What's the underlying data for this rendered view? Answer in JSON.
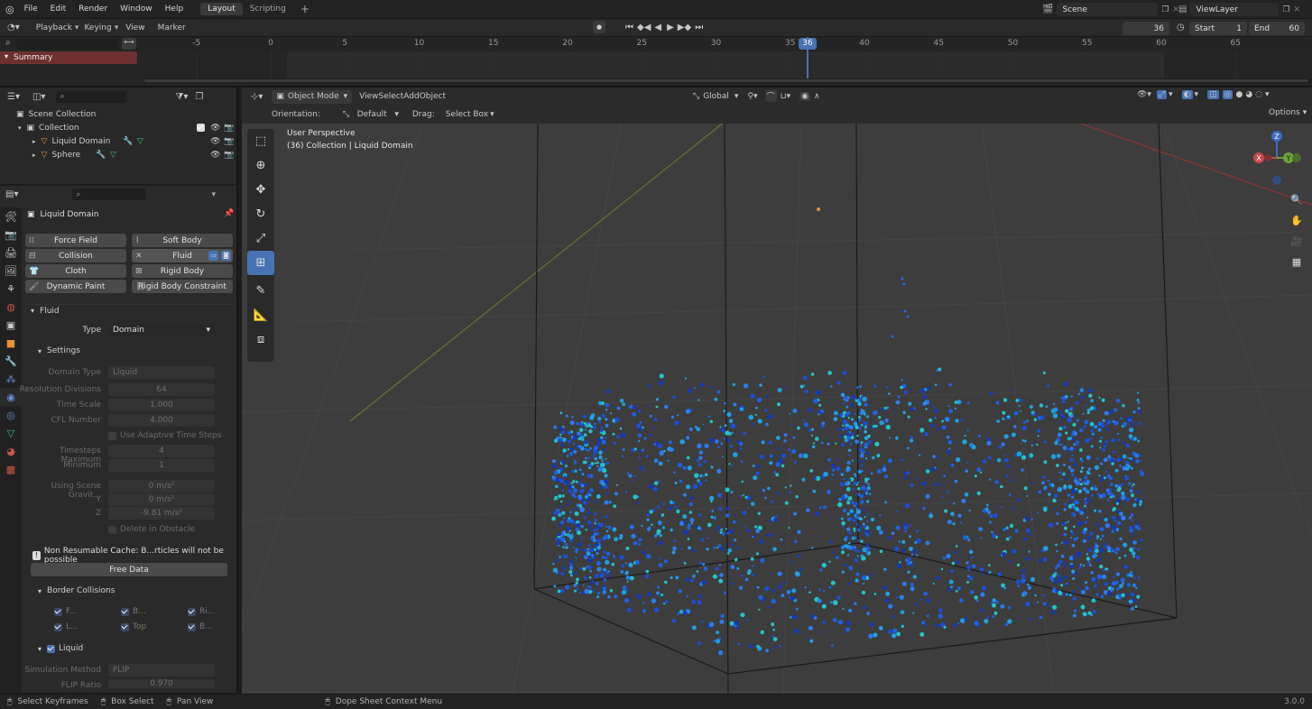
{
  "topbar": {
    "menus": [
      "File",
      "Edit",
      "Render",
      "Window",
      "Help"
    ],
    "workspaces": [
      {
        "label": "Layout",
        "active": true
      },
      {
        "label": "Scripting",
        "active": false
      }
    ],
    "add_tab": "+",
    "scene": "Scene",
    "view_layer": "ViewLayer"
  },
  "timeline": {
    "menus": [
      "Playback",
      "Keying",
      "View",
      "Marker"
    ],
    "current_frame": "36",
    "start_label": "Start",
    "start": "1",
    "end_label": "End",
    "end": "60",
    "summary": "Summary",
    "ticks": [
      "-5",
      "0",
      "5",
      "10",
      "15",
      "20",
      "25",
      "30",
      "35",
      "36",
      "40",
      "45",
      "50",
      "55",
      "60",
      "65"
    ]
  },
  "outliner": {
    "scene_collection": "Scene Collection",
    "collection": "Collection",
    "items": [
      "Liquid Domain",
      "Sphere"
    ]
  },
  "properties": {
    "object_name": "Liquid Domain",
    "physics_buttons": [
      {
        "label": "Force Field",
        "icon": "field-icon"
      },
      {
        "label": "Soft Body",
        "icon": "softbody-icon"
      },
      {
        "label": "Collision",
        "icon": "collision-icon"
      },
      {
        "label": "Fluid",
        "icon": "close-icon"
      },
      {
        "label": "Cloth",
        "icon": "cloth-icon"
      },
      {
        "label": "Rigid Body",
        "icon": "rigidbody-icon"
      },
      {
        "label": "Dynamic Paint",
        "icon": "brush-icon"
      },
      {
        "label": "Rigid Body Constraint",
        "icon": "constraint-icon"
      }
    ],
    "fluid_panel": "Fluid",
    "type_label": "Type",
    "type_value": "Domain",
    "settings_panel": "Settings",
    "settings": [
      {
        "label": "Domain Type",
        "value": "Liquid"
      },
      {
        "label": "Resolution Divisions",
        "value": "64"
      },
      {
        "label": "Time Scale",
        "value": "1.000"
      },
      {
        "label": "CFL Number",
        "value": "4.000"
      },
      {
        "label": "Use Adaptive Time Steps",
        "value": ""
      },
      {
        "label": "Timesteps Maximum",
        "value": "4"
      },
      {
        "label": "Minimum",
        "value": "1"
      },
      {
        "label": "Using Scene Gravit...",
        "value": "0 m/s²"
      },
      {
        "label": "Y",
        "value": "0 m/s²"
      },
      {
        "label": "Z",
        "value": "-9.81 m/s²"
      },
      {
        "label": "Delete in Obstacle",
        "value": ""
      }
    ],
    "warning": "Non Resumable Cache: B...rticles will not be possible",
    "free_data": "Free Data",
    "border_panel": "Border Collisions",
    "border_items": [
      "F...",
      "B...",
      "Ri...",
      "L...",
      "Top",
      "B..."
    ],
    "liquid_panel": "Liquid",
    "liquid_settings": [
      {
        "label": "Simulation Method",
        "value": "FLIP"
      },
      {
        "label": "FLIP Ratio",
        "value": "0.970"
      }
    ]
  },
  "viewport": {
    "mode": "Object Mode",
    "menus": [
      "View",
      "Select",
      "Add",
      "Object"
    ],
    "transform": "Global",
    "orientation_label": "Orientation:",
    "orientation": "Default",
    "drag_label": "Drag:",
    "drag": "Select Box",
    "options": "Options",
    "perspective": "User Perspective",
    "collection_info": "(36) Collection | Liquid Domain",
    "gizmo_axes": [
      "Z",
      "X",
      "Y"
    ]
  },
  "statusbar": {
    "items": [
      "Select Keyframes",
      "Box Select",
      "Pan View",
      "Dope Sheet Context Menu"
    ],
    "version": "3.0.0"
  }
}
